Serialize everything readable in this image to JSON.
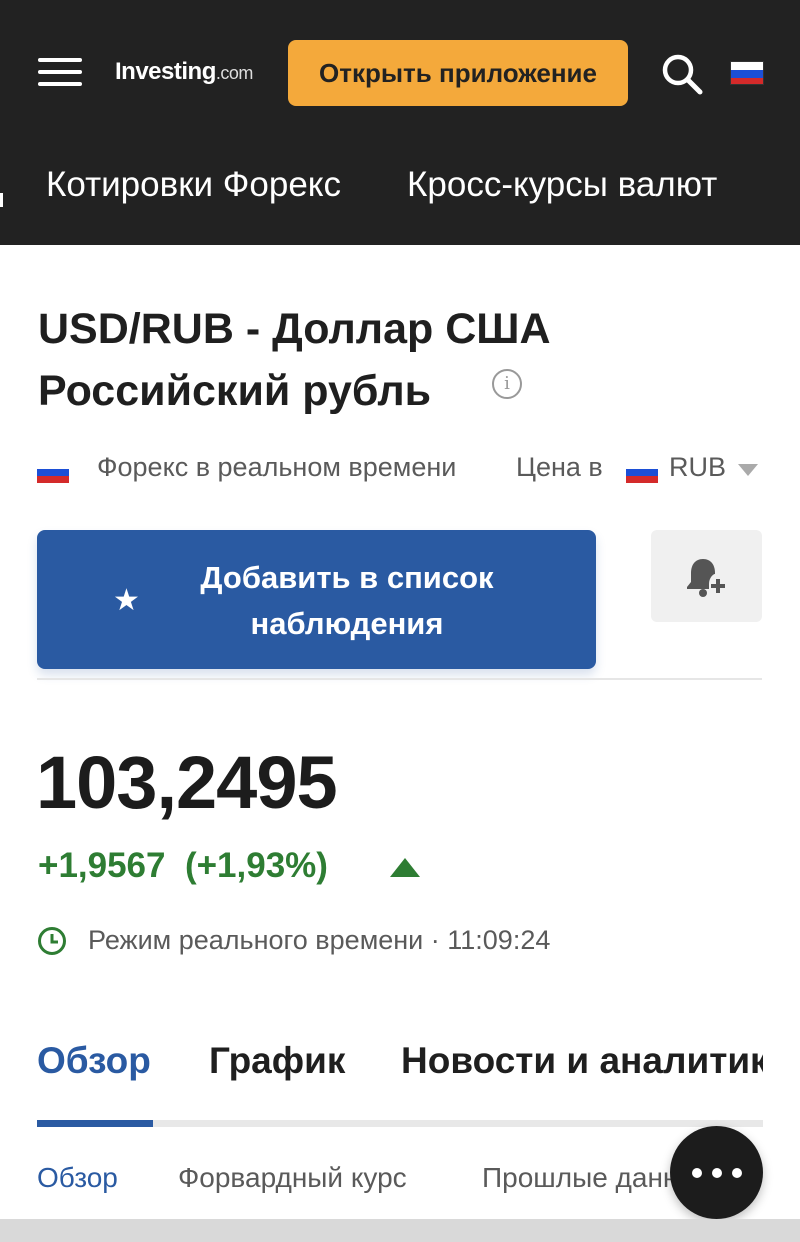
{
  "header": {
    "logo_main": "Investing",
    "logo_suffix": ".com",
    "open_app_label": "Открыть приложение",
    "icons": [
      "menu-icon",
      "search-icon",
      "russia-flag-icon"
    ]
  },
  "nav": {
    "items": [
      "Котировки Форекс",
      "Кросс-курсы валют"
    ]
  },
  "instrument": {
    "title_line1": "USD/RUB - Доллар США",
    "title_line2": "Российский рубль",
    "info_glyph": "i",
    "market_label": "Форекс в реальном времени",
    "price_in_label": "Цена в",
    "currency": "RUB"
  },
  "actions": {
    "watchlist_line1": "Добавить в список",
    "watchlist_line2": "наблюдения",
    "alert_icon": "bell-plus-icon"
  },
  "quote": {
    "price": "103,2495",
    "change": "+1,9567",
    "change_pct": "(+1,93%)",
    "direction": "up",
    "mode_label": "Режим реального времени",
    "time": "11:09:24"
  },
  "tabs": [
    "Обзор",
    "График",
    "Новости и аналитика"
  ],
  "subtabs": [
    "Обзор",
    "Форвардный курс",
    "Прошлые данные"
  ],
  "colors": {
    "header_bg": "#222222",
    "accent_orange": "#f4a93b",
    "primary_blue": "#2a5aa2",
    "positive_green": "#2e7d33"
  }
}
